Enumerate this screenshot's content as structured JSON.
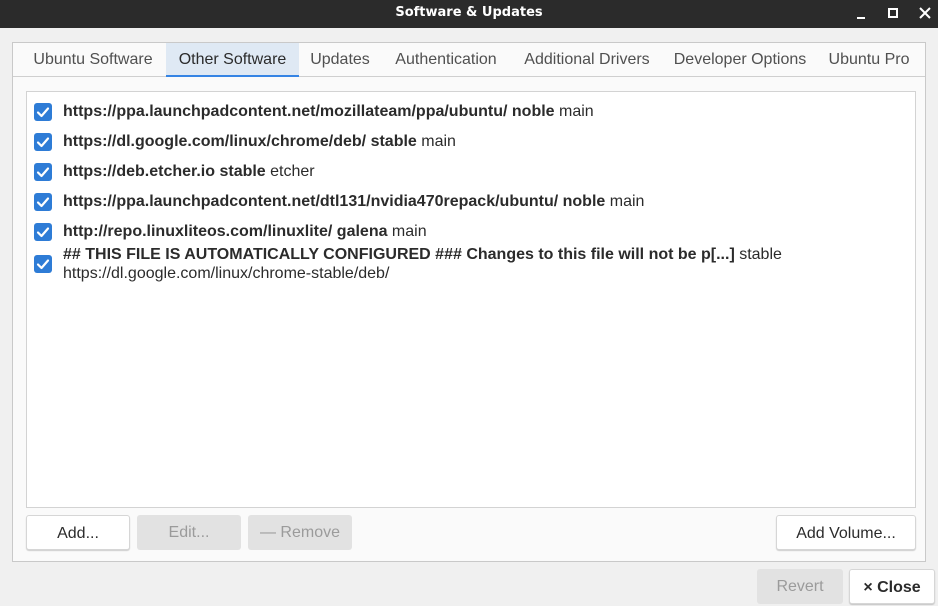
{
  "window": {
    "title": "Software & Updates",
    "controls": {
      "minimize": "minimize",
      "maximize": "maximize",
      "close": "close"
    }
  },
  "tabs": [
    {
      "label": "Ubuntu Software",
      "active": false
    },
    {
      "label": "Other Software",
      "active": true
    },
    {
      "label": "Updates",
      "active": false
    },
    {
      "label": "Authentication",
      "active": false
    },
    {
      "label": "Additional Drivers",
      "active": false
    },
    {
      "label": "Developer Options",
      "active": false
    },
    {
      "label": "Ubuntu Pro",
      "active": false
    }
  ],
  "sources": [
    {
      "checked": true,
      "bold": "https://ppa.launchpadcontent.net/mozillateam/ppa/ubuntu/ noble",
      "rest": " main",
      "line2": ""
    },
    {
      "checked": true,
      "bold": "https://dl.google.com/linux/chrome/deb/ stable",
      "rest": " main",
      "line2": ""
    },
    {
      "checked": true,
      "bold": "https://deb.etcher.io stable",
      "rest": " etcher",
      "line2": ""
    },
    {
      "checked": true,
      "bold": "https://ppa.launchpadcontent.net/dtl131/nvidia470repack/ubuntu/ noble",
      "rest": " main",
      "line2": ""
    },
    {
      "checked": true,
      "bold": "http://repo.linuxliteos.com/linuxlite/ galena",
      "rest": " main",
      "line2": ""
    },
    {
      "checked": true,
      "bold": "## THIS FILE IS AUTOMATICALLY CONFIGURED ###  Changes to this file will not be p[...]",
      "rest": " stable",
      "line2": "https://dl.google.com/linux/chrome-stable/deb/"
    }
  ],
  "buttons": {
    "add": "Add...",
    "edit": "Edit...",
    "remove": "— Remove",
    "add_volume": "Add Volume...",
    "revert": "Revert",
    "close": "× Close"
  },
  "colors": {
    "accent": "#3584e4",
    "checkbox": "#2e7cd6",
    "titlebar": "#2b2b2b"
  }
}
